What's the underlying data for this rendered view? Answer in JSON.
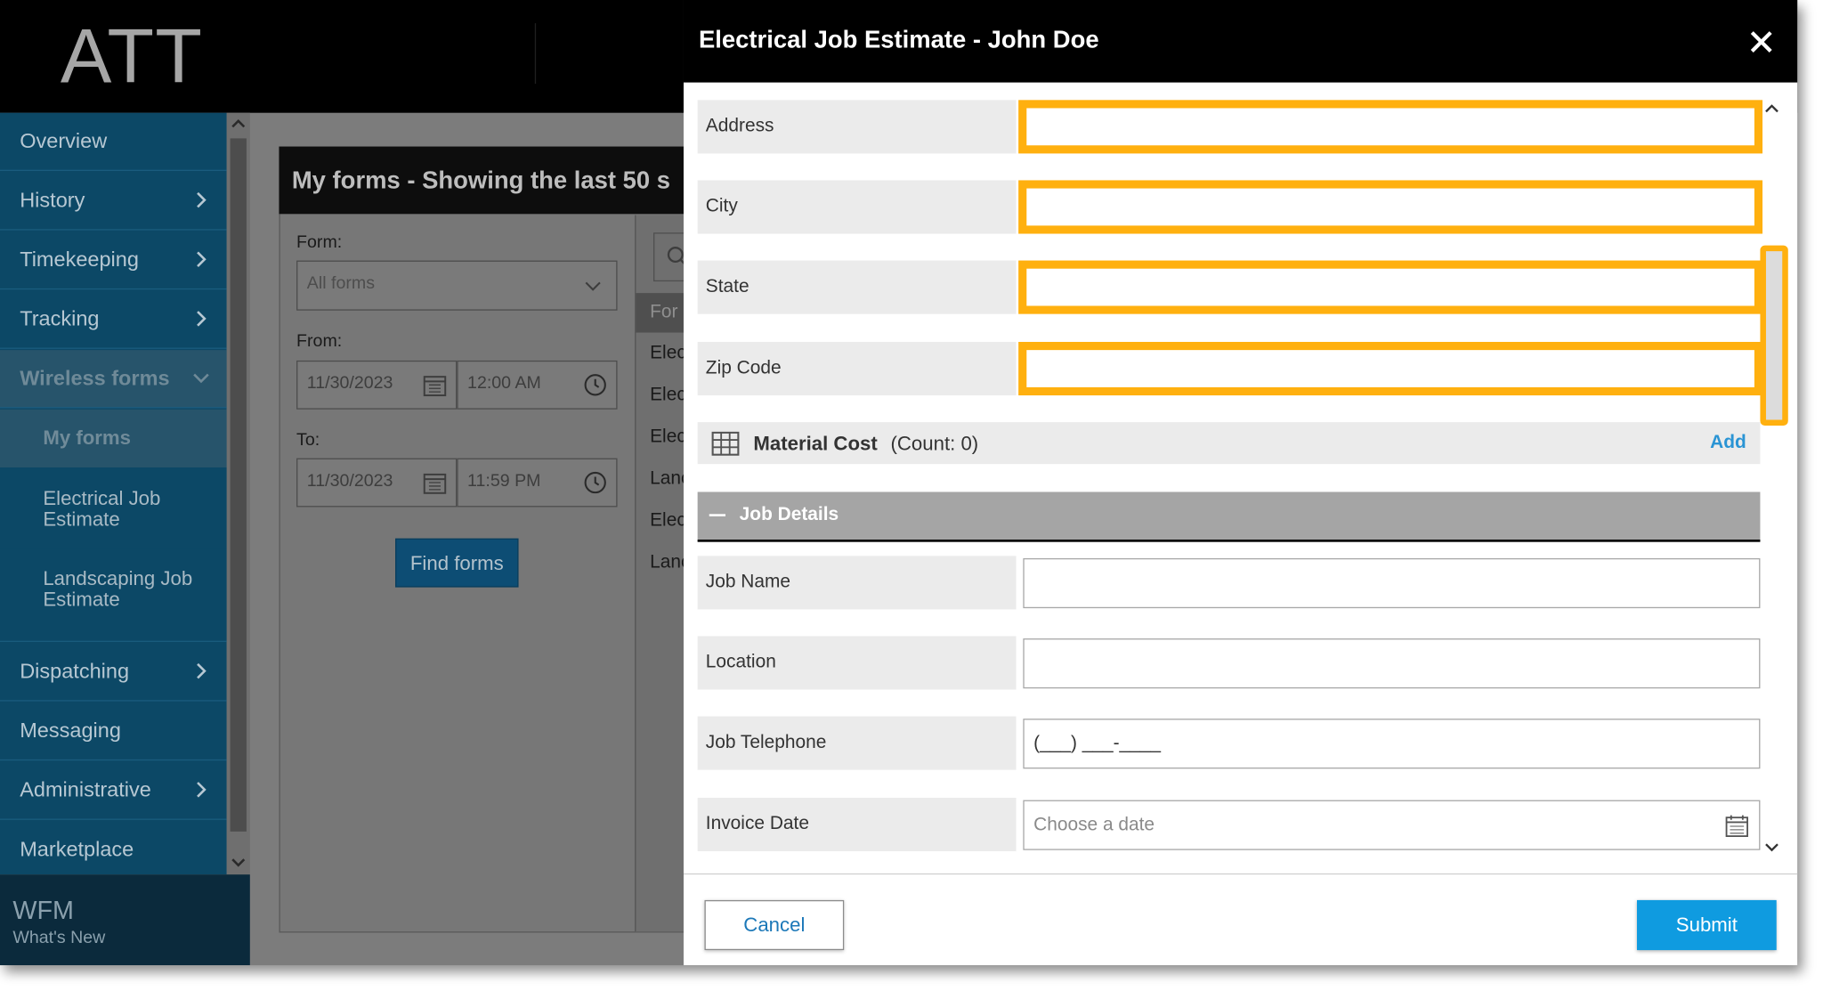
{
  "header": {
    "logo": "ATT"
  },
  "sidebar": {
    "items": [
      {
        "label": "Overview"
      },
      {
        "label": "History"
      },
      {
        "label": "Timekeeping"
      },
      {
        "label": "Tracking"
      },
      {
        "label": "Wireless forms"
      },
      {
        "label": "Dispatching"
      },
      {
        "label": "Messaging"
      },
      {
        "label": "Administrative"
      },
      {
        "label": "Marketplace"
      }
    ],
    "sub_items": [
      {
        "label": "My forms"
      },
      {
        "label": "Electrical Job Estimate"
      },
      {
        "label": "Landscaping Job Estimate"
      }
    ],
    "footer": {
      "title": "WFM",
      "subtitle": "What's New"
    }
  },
  "background": {
    "title": "My forms - Showing the last 50 s",
    "form_label": "Form:",
    "form_value": "All forms",
    "from_label": "From:",
    "from_date": "11/30/2023",
    "from_time": "12:00 AM",
    "to_label": "To:",
    "to_date": "11/30/2023",
    "to_time": "11:59 PM",
    "find_button": "Find forms",
    "list_header": "For",
    "list_rows": [
      "Elec",
      "Elec",
      "Elec",
      "Lanc",
      "Elec",
      "Lanc"
    ]
  },
  "modal": {
    "title": "Electrical Job Estimate - John Doe",
    "fields_top": [
      {
        "label": "Address",
        "value": ""
      },
      {
        "label": "City",
        "value": ""
      },
      {
        "label": "State",
        "value": ""
      },
      {
        "label": "Zip Code",
        "value": ""
      }
    ],
    "material_cost": {
      "title": "Material Cost",
      "count": "(Count: 0)",
      "add": "Add"
    },
    "section_title": "Job Details",
    "fields_job": [
      {
        "label": "Job Name",
        "value": ""
      },
      {
        "label": "Location",
        "value": ""
      },
      {
        "label": "Job Telephone",
        "value": "(___) ___-____"
      },
      {
        "label": "Invoice Date",
        "placeholder": "Choose a date"
      }
    ],
    "cancel": "Cancel",
    "submit": "Submit"
  },
  "colors": {
    "highlight": "#ffb00f",
    "sidebar": "#0c4866",
    "submit": "#0f9be0",
    "link": "#2a94d4"
  }
}
